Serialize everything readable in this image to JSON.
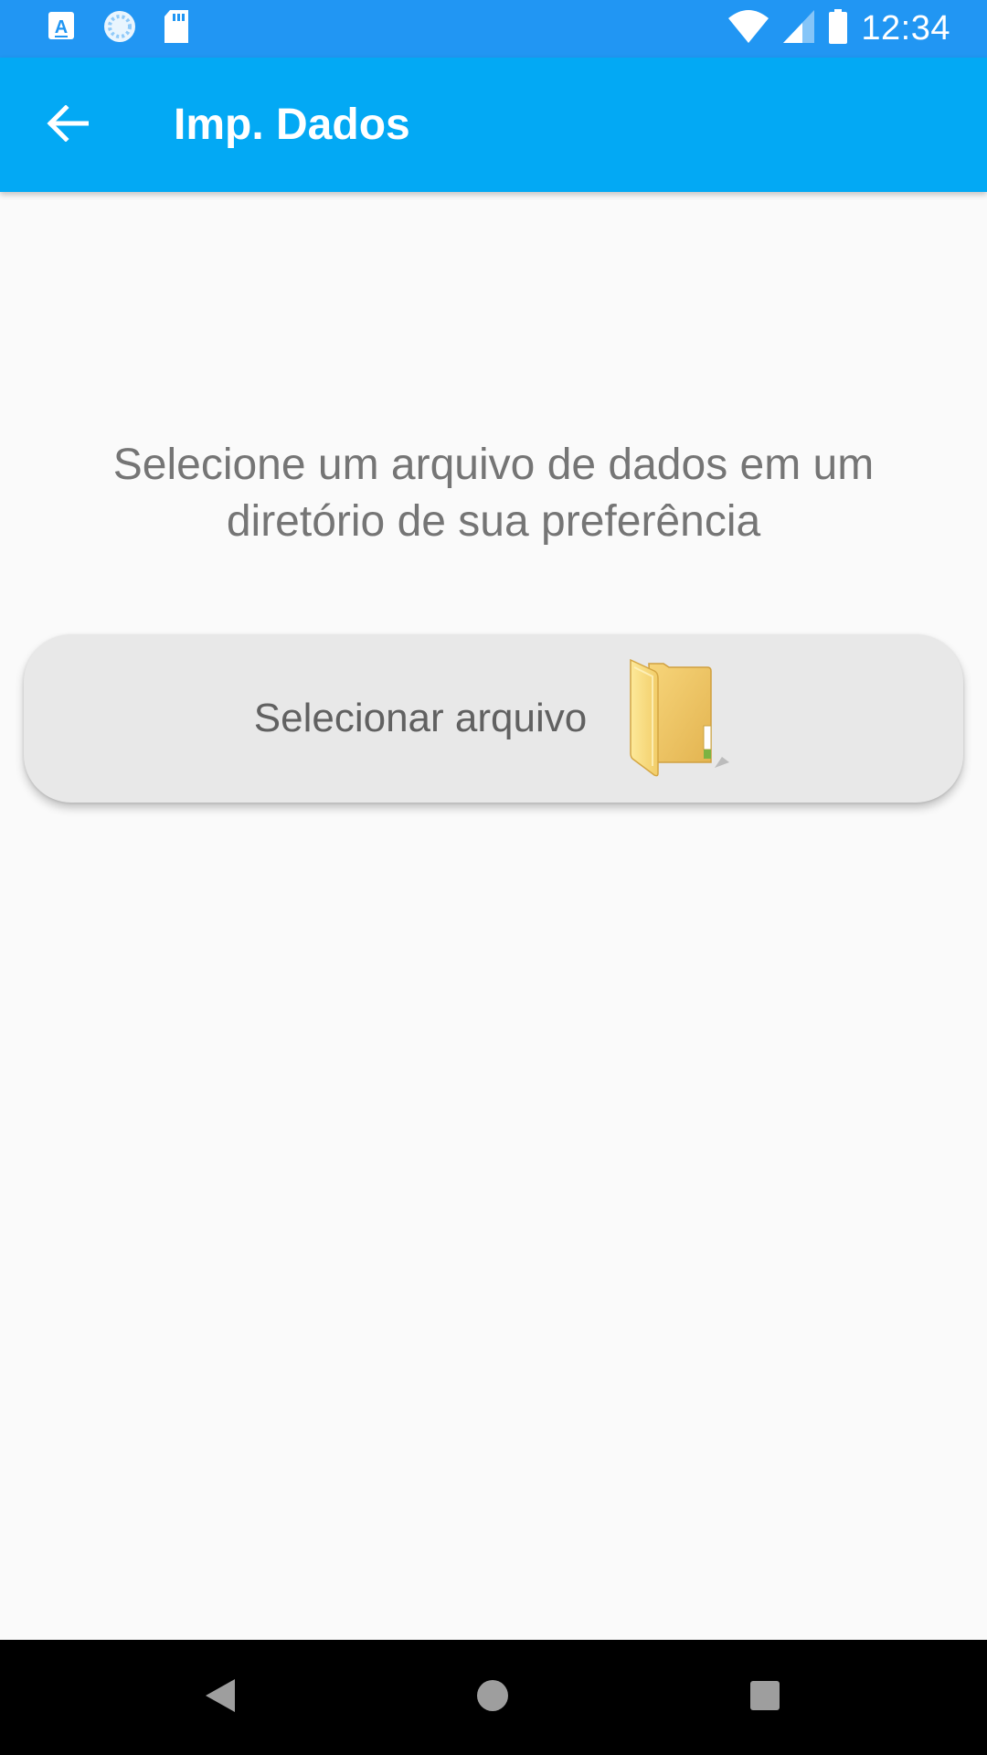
{
  "status_bar": {
    "time": "12:34",
    "left_icons": [
      "app-a-icon",
      "sync-icon",
      "sd-card-icon"
    ],
    "right_icons": [
      "wifi-icon",
      "cellular-signal-icon",
      "battery-icon"
    ]
  },
  "app_bar": {
    "title": "Imp. Dados",
    "back_icon": "arrow-back-icon",
    "color": "#03a9f4"
  },
  "main": {
    "instruction": "Selecione um arquivo de dados em um diretório de sua preferência",
    "select_button": {
      "label": "Selecionar arquivo",
      "icon": "folder-icon"
    }
  },
  "nav_bar": {
    "buttons": [
      "back-triangle-icon",
      "home-circle-icon",
      "recents-square-icon"
    ]
  },
  "colors": {
    "status_bar": "#2196f3",
    "app_bar": "#03a9f4",
    "background": "#fafafa",
    "button": "#e8e8e8",
    "text": "#757575"
  }
}
